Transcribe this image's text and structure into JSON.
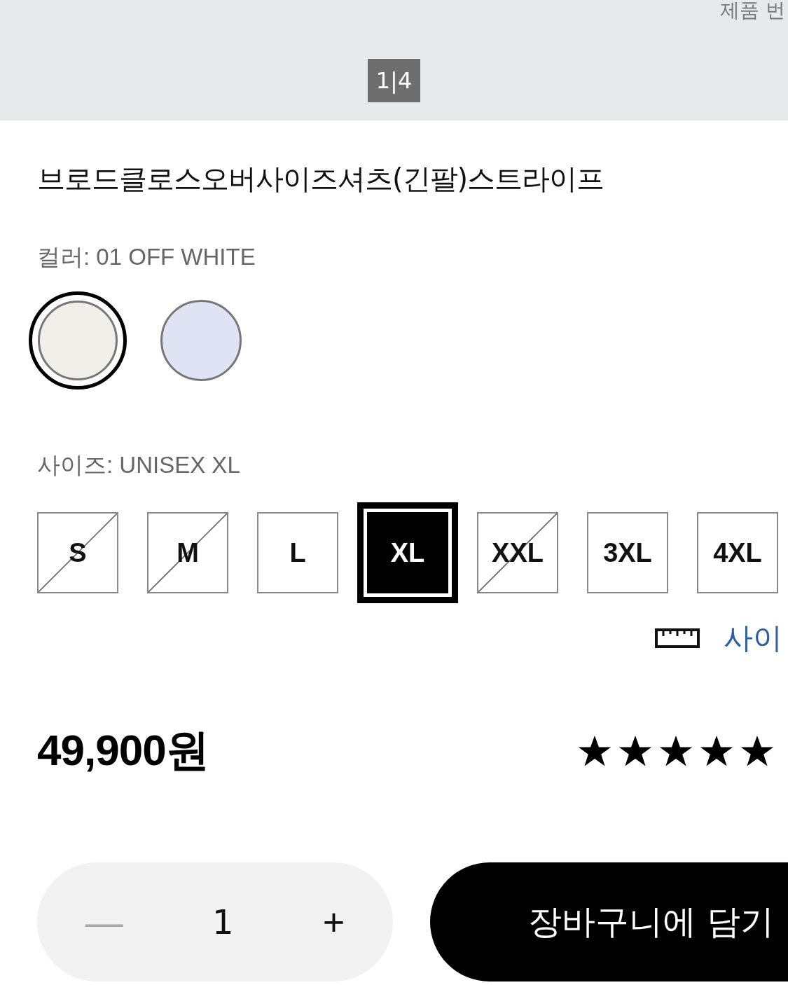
{
  "gallery": {
    "product_number_label": "제품 번",
    "page_indicator": "1|4"
  },
  "product": {
    "title": "브로드클로스오버사이즈셔츠(긴팔)스트라이프"
  },
  "color": {
    "label": "컬러: 01 OFF WHITE",
    "swatches": [
      {
        "color": "#f0efea",
        "selected": true
      },
      {
        "color": "#dfe3f3",
        "selected": false
      }
    ]
  },
  "size": {
    "label": "사이즈: UNISEX XL",
    "options": [
      {
        "label": "S",
        "available": false,
        "selected": false
      },
      {
        "label": "M",
        "available": false,
        "selected": false
      },
      {
        "label": "L",
        "available": true,
        "selected": false
      },
      {
        "label": "XL",
        "available": true,
        "selected": true
      },
      {
        "label": "XXL",
        "available": false,
        "selected": false
      },
      {
        "label": "3XL",
        "available": true,
        "selected": false
      },
      {
        "label": "4XL",
        "available": true,
        "selected": false
      }
    ],
    "guide_link": "사이"
  },
  "price": "49,900원",
  "rating": {
    "stars": 5
  },
  "quantity": {
    "minus": "—",
    "value": "1",
    "plus": "+"
  },
  "add_to_cart": "장바구니에 담기"
}
